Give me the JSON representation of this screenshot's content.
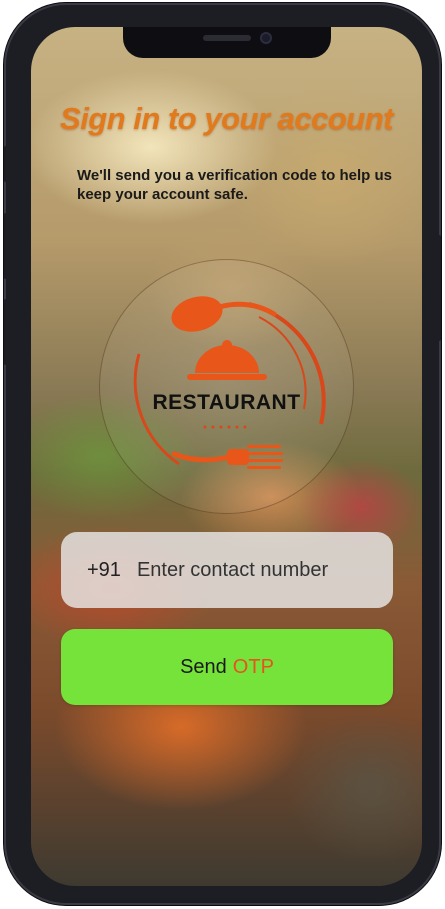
{
  "header": {
    "title": "Sign in to your account",
    "subtitle": "We'll send you a verification code to help us keep your account safe."
  },
  "logo": {
    "text": "RESTAURANT",
    "icons": [
      "spoon-icon",
      "cloche-icon",
      "fork-icon"
    ],
    "accent_color": "#e8561a"
  },
  "form": {
    "country_code": "+91",
    "phone_placeholder": "Enter contact number",
    "phone_value": ""
  },
  "actions": {
    "send_label": "Send",
    "send_label_highlight": "OTP"
  },
  "colors": {
    "title": "#e07a1c",
    "button_bg": "#76e33b",
    "otp_text": "#e5531f",
    "input_bg": "#e8e8e8"
  }
}
